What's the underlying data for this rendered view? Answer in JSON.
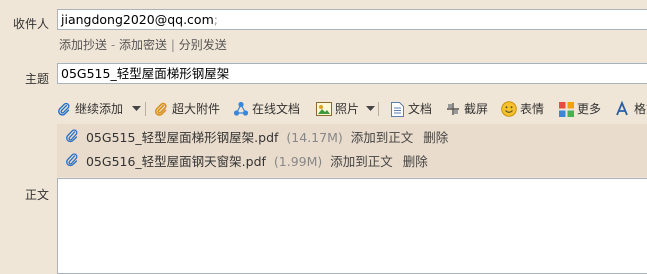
{
  "to": {
    "label": "收件人",
    "value": "jiangdong2020@qq.com",
    "separator": ";"
  },
  "recipient_links": {
    "cc": "添加抄送",
    "dash": "-",
    "bcc": "添加密送",
    "pipe": "|",
    "separate": "分别发送"
  },
  "subject": {
    "label": "主题",
    "value": "05G515_轻型屋面梯形钢屋架"
  },
  "toolbar": {
    "attach": "继续添加",
    "big_attach": "超大附件",
    "online_doc": "在线文档",
    "photo": "照片",
    "doc": "文档",
    "screenshot": "截屏",
    "emoji": "表情",
    "more": "更多",
    "format": "格式"
  },
  "attachments": [
    {
      "name": "05G515_轻型屋面梯形钢屋架.pdf",
      "size": "(14.17M)",
      "add_to_body": "添加到正文",
      "delete": "删除"
    },
    {
      "name": "05G516_轻型屋面钢天窗架.pdf",
      "size": "(1.99M)",
      "add_to_body": "添加到正文",
      "delete": "删除"
    }
  ],
  "body": {
    "label": "正文",
    "value": ""
  },
  "colors": {
    "background": "#f0e6d7",
    "attach_panel": "#e9dccc",
    "border": "#a9b2bd"
  }
}
